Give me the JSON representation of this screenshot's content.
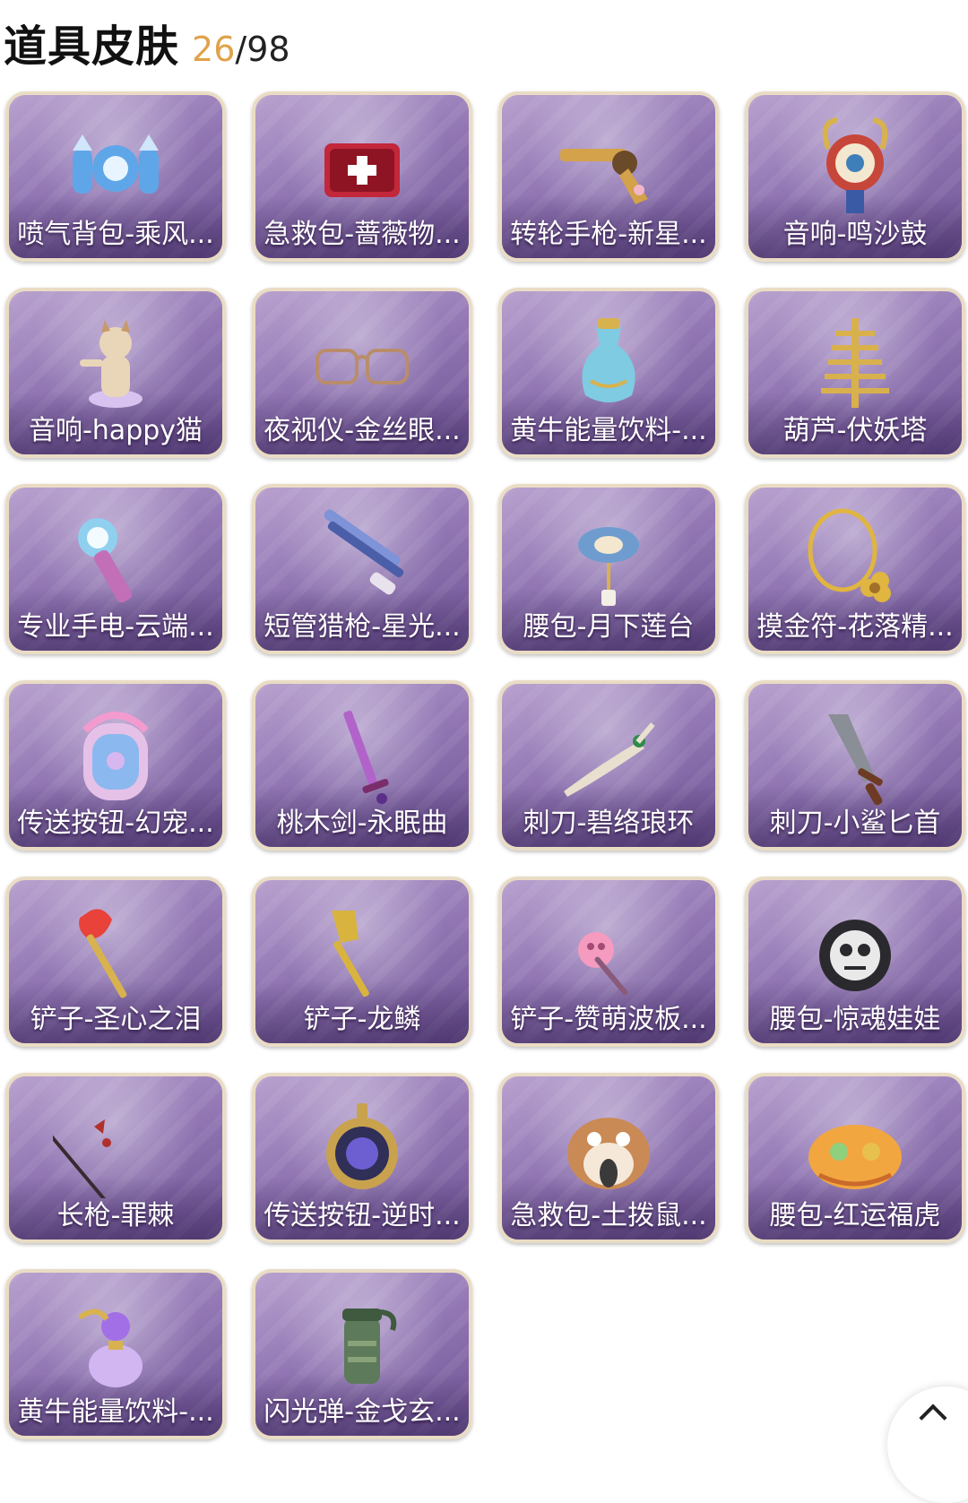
{
  "header": {
    "title": "道具皮肤",
    "owned": "26",
    "separator": "/",
    "total": "98"
  },
  "items": [
    {
      "label": "喷气背包-乘风...",
      "icon": "jetpack-icon",
      "accent": "#5fa6e8"
    },
    {
      "label": "急救包-蔷薇物...",
      "icon": "first-aid-kit-icon",
      "accent": "#c2273a"
    },
    {
      "label": "转轮手枪-新星...",
      "icon": "revolver-icon",
      "accent": "#d3a24b"
    },
    {
      "label": "音响-鸣沙鼓",
      "icon": "drum-icon",
      "accent": "#d8b24e"
    },
    {
      "label": "音响-happy猫",
      "icon": "cat-figure-icon",
      "accent": "#e9d6b8"
    },
    {
      "label": "夜视仪-金丝眼...",
      "icon": "glasses-icon",
      "accent": "#b98d6c"
    },
    {
      "label": "黄牛能量饮料-...",
      "icon": "potion-bottle-icon",
      "accent": "#7fcbe2"
    },
    {
      "label": "葫芦-伏妖塔",
      "icon": "pagoda-icon",
      "accent": "#d9b14c"
    },
    {
      "label": "专业手电-云端...",
      "icon": "flashlight-icon",
      "accent": "#8fd0ef"
    },
    {
      "label": "短管猎枪-星光...",
      "icon": "shotgun-icon",
      "accent": "#7e93d8"
    },
    {
      "label": "腰包-月下莲台",
      "icon": "lotus-pendant-icon",
      "accent": "#6f9ccf"
    },
    {
      "label": "摸金符-花落精...",
      "icon": "flower-charm-icon",
      "accent": "#e0b540"
    },
    {
      "label": "传送按钮-幻宠...",
      "icon": "teleport-device-icon",
      "accent": "#8bb8ef"
    },
    {
      "label": "桃木剑-永眠曲",
      "icon": "sword-icon",
      "accent": "#b163c9"
    },
    {
      "label": "刺刀-碧络琅环",
      "icon": "dagger-icon",
      "accent": "#e8dfcf"
    },
    {
      "label": "刺刀-小鲨匕首",
      "icon": "shark-knife-icon",
      "accent": "#8a8e96"
    },
    {
      "label": "铲子-圣心之泪",
      "icon": "shovel-heart-icon",
      "accent": "#e8423a"
    },
    {
      "label": "铲子-龙鳞",
      "icon": "golden-shovel-icon",
      "accent": "#d8b43e"
    },
    {
      "label": "铲子-赞萌波板...",
      "icon": "pink-shovel-icon",
      "accent": "#f49bbf"
    },
    {
      "label": "腰包-惊魂娃娃",
      "icon": "skull-doll-icon",
      "accent": "#e9e9e9"
    },
    {
      "label": "长枪-罪棘",
      "icon": "spear-icon",
      "accent": "#b0302b"
    },
    {
      "label": "传送按钮-逆时...",
      "icon": "clock-orb-icon",
      "accent": "#6d5fd1"
    },
    {
      "label": "急救包-土拨鼠...",
      "icon": "hamster-icon",
      "accent": "#c98a55"
    },
    {
      "label": "腰包-红运福虎",
      "icon": "tiger-bag-icon",
      "accent": "#f2a640"
    },
    {
      "label": "黄牛能量饮料-...",
      "icon": "crystal-bottle-icon",
      "accent": "#a26fe6"
    },
    {
      "label": "闪光弹-金戈玄...",
      "icon": "flashbang-icon",
      "accent": "#5d7a5a"
    }
  ]
}
